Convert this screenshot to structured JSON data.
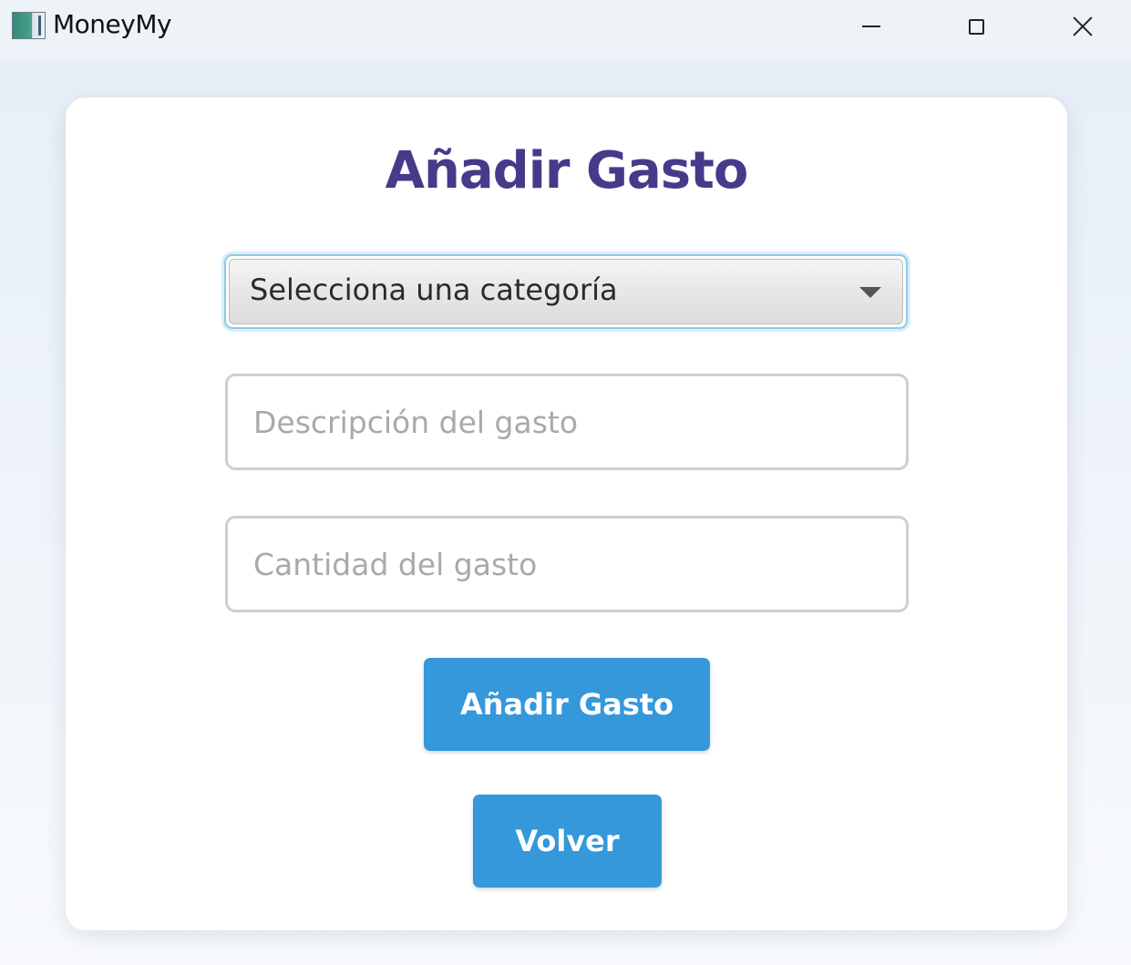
{
  "window": {
    "title": "MoneyMy",
    "icon": "app-icon",
    "controls": {
      "minimize_icon": "minimize-icon",
      "maximize_icon": "maximize-icon",
      "close_icon": "close-icon"
    }
  },
  "form": {
    "title": "Añadir Gasto",
    "category_select": {
      "selected_value": "Selecciona una categoría",
      "icon": "chevron-down-icon"
    },
    "description_field": {
      "value": "",
      "placeholder": "Descripción del gasto"
    },
    "amount_field": {
      "value": "",
      "placeholder": "Cantidad del gasto"
    },
    "add_button_label": "Añadir Gasto",
    "back_button_label": "Volver"
  },
  "colors": {
    "title": "#463a8a",
    "button": "#3498db",
    "select_focus_border": "#8fc9e6"
  }
}
